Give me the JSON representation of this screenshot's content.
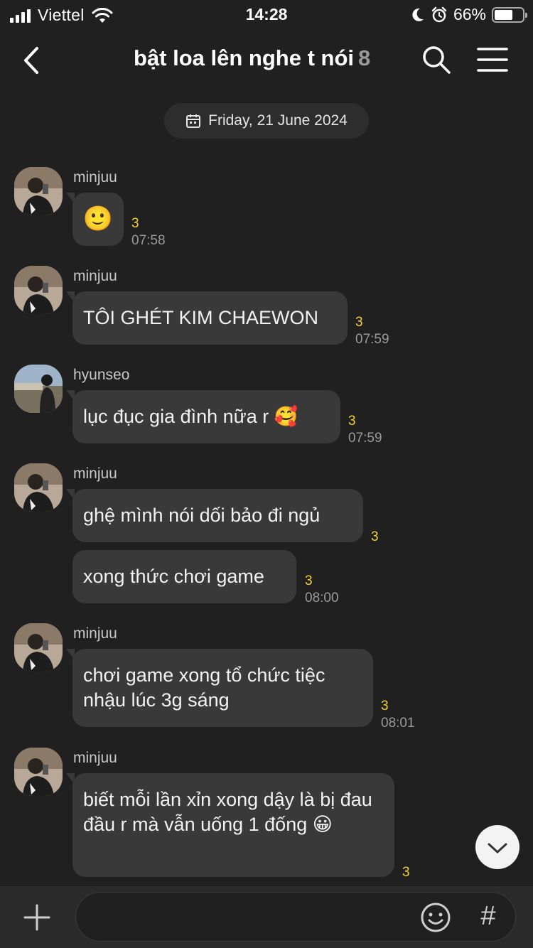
{
  "status_bar": {
    "carrier": "Viettel",
    "time": "14:28",
    "battery_percent": "66%",
    "battery_level": 0.66
  },
  "header": {
    "title": "bật loa lên nghe t nói",
    "member_count": "8"
  },
  "date_divider": "Friday, 21 June 2024",
  "messages": [
    {
      "sender": "minjuu",
      "text": "🙂",
      "unread": "3",
      "time": "07:58"
    },
    {
      "sender": "minjuu",
      "text": "TÔI GHÉT KIM CHAEWON",
      "unread": "3",
      "time": "07:59"
    },
    {
      "sender": "hyunseo",
      "text": "lục đục gia đình nữa r 🥰",
      "unread": "3",
      "time": "07:59"
    },
    {
      "sender": "minjuu",
      "text": "ghệ mình nói dối bảo đi ngủ",
      "unread": "3",
      "time": ""
    },
    {
      "sender": "",
      "text": "xong thức chơi game",
      "unread": "3",
      "time": "08:00"
    },
    {
      "sender": "minjuu",
      "text": "chơi game xong tổ chức tiệc nhậu lúc 3g sáng",
      "unread": "3",
      "time": "08:01"
    },
    {
      "sender": "minjuu",
      "text": "biết mỗi lần xỉn xong dậy là bị đau đầu r mà vẫn uống 1 đống 😀",
      "unread": "3",
      "time": ""
    }
  ],
  "input": {
    "placeholder": "",
    "hash_symbol": "#"
  },
  "colors": {
    "background": "#202020",
    "bubble": "#393939",
    "unread_count": "#f5d22a",
    "timestamp": "#9a9a9a"
  },
  "icons": [
    "back-arrow-icon",
    "search-icon",
    "menu-icon",
    "calendar-icon",
    "emoji-icon",
    "plus-icon",
    "chevron-down-icon"
  ]
}
